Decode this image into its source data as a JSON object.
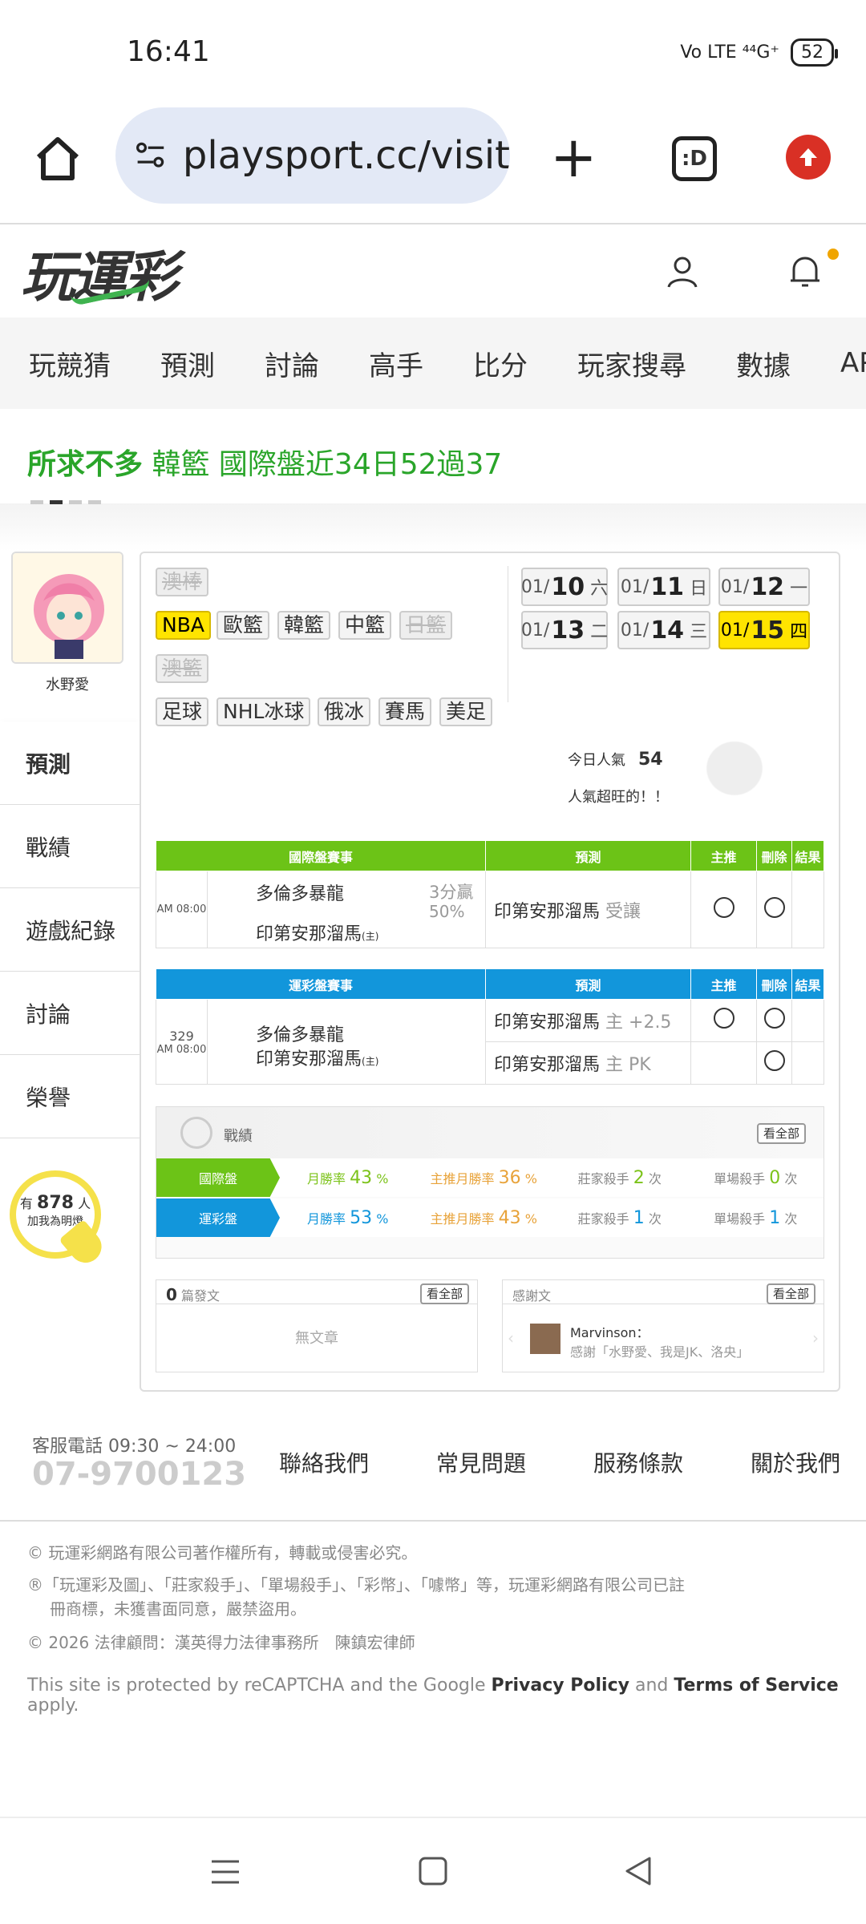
{
  "status": {
    "time": "16:41",
    "network": "Vo LTE ⁴⁴G⁺",
    "battery": "52"
  },
  "browser": {
    "url": "playsport.cc/visit",
    "tab_label": ":D"
  },
  "site": {
    "logo": "玩運彩"
  },
  "nav": {
    "items": [
      "玩競猜",
      "預測",
      "討論",
      "高手",
      "比分",
      "玩家搜尋",
      "數據",
      "APP"
    ]
  },
  "marquee": {
    "prefix": "所求不多",
    "text": "韓籃 國際盤近34日52過37"
  },
  "profile": {
    "name": "水野愛",
    "fans_pre": "有",
    "fans_count": "878",
    "fans_post": "人",
    "fans_sub": "加我為明燈"
  },
  "side_tabs": [
    "預測",
    "戰績",
    "遊戲紀錄",
    "討論",
    "榮譽"
  ],
  "leagues": {
    "row0": "澳棒",
    "row1": [
      "NBA",
      "歐籃",
      "韓籃",
      "中籃",
      "日籃"
    ],
    "row2": "澳籃",
    "row3": [
      "足球",
      "NHL冰球",
      "俄冰",
      "賽馬",
      "美足"
    ]
  },
  "dates": [
    {
      "pre": "01/",
      "day": "10",
      "wk": "六"
    },
    {
      "pre": "01/",
      "day": "11",
      "wk": "日"
    },
    {
      "pre": "01/",
      "day": "12",
      "wk": "一"
    },
    {
      "pre": "01/",
      "day": "13",
      "wk": "二"
    },
    {
      "pre": "01/",
      "day": "14",
      "wk": "三"
    },
    {
      "pre": "01/",
      "day": "15",
      "wk": "四"
    }
  ],
  "popularity": {
    "label": "今日人氣",
    "value": "54",
    "note": "人氣超旺的！！"
  },
  "intl": {
    "headers": [
      "國際盤賽事",
      "預測",
      "主推",
      "刪除",
      "結果"
    ],
    "time": "AM 08:00",
    "team1": "多倫多暴龍",
    "team2": "印第安那溜馬",
    "home": "(主)",
    "line1": "3分贏",
    "line2": "50%",
    "pick": "印第安那溜馬",
    "pick_note": "受讓"
  },
  "lottery": {
    "headers": [
      "運彩盤賽事",
      "預測",
      "主推",
      "刪除",
      "結果"
    ],
    "num": "329",
    "time": "AM 08:00",
    "team1": "多倫多暴龍",
    "team2": "印第安那溜馬",
    "home": "(主)",
    "pick1": "印第安那溜馬",
    "pick1_note": "主 +2.5",
    "pick2": "印第安那溜馬",
    "pick2_note": "主 PK"
  },
  "record": {
    "title": "戰績",
    "more": "看全部",
    "rows": [
      {
        "tag": "國際盤",
        "c1l": "月勝率",
        "c1v": "43",
        "c1u": "%",
        "c2l": "主推月勝率",
        "c2v": "36",
        "c2u": "%",
        "c3l": "莊家殺手",
        "c3v": "2",
        "c3u": "次",
        "c4l": "單場殺手",
        "c4v": "0",
        "c4u": "次"
      },
      {
        "tag": "運彩盤",
        "c1l": "月勝率",
        "c1v": "53",
        "c1u": "%",
        "c2l": "主推月勝率",
        "c2v": "43",
        "c2u": "%",
        "c3l": "莊家殺手",
        "c3v": "1",
        "c3u": "次",
        "c4l": "單場殺手",
        "c4v": "1",
        "c4u": "次"
      }
    ]
  },
  "posts": {
    "count": "0",
    "label": "篇發文",
    "more": "看全部",
    "empty": "無文章"
  },
  "thanks": {
    "title": "感謝文",
    "more": "看全部",
    "user": "Marvinson：",
    "text": "感謝「水野愛、我是JK、洛央」"
  },
  "footer": {
    "phone_label": "客服電話 09:30 ~ 24:00",
    "phone": "07-9700123",
    "links": [
      "聯絡我們",
      "常見問題",
      "服務條款",
      "關於我們"
    ],
    "copy1": "© 玩運彩網路有限公司著作權所有，轉載或侵害必究。",
    "copy2a": "®「玩運彩及圖」、「莊家殺手」、「單場殺手」、「彩幣」、「噱幣」等，玩運彩網路有限公司已註",
    "copy2b": "冊商標，未獲書面同意，嚴禁盜用。",
    "copy3": "© 2026 法律顧問：漢英得力法律事務所　陳鎮宏律師",
    "recap_pre": "This site is protected by reCAPTCHA and the Google ",
    "recap_pp": "Privacy Policy",
    "recap_and": " and ",
    "recap_tos": "Terms of Service",
    "recap_post": " apply."
  },
  "colors": {
    "green": "#6cc317",
    "blue": "#1296db",
    "yellow": "#ffe400",
    "brand_green": "#2aa52a"
  }
}
